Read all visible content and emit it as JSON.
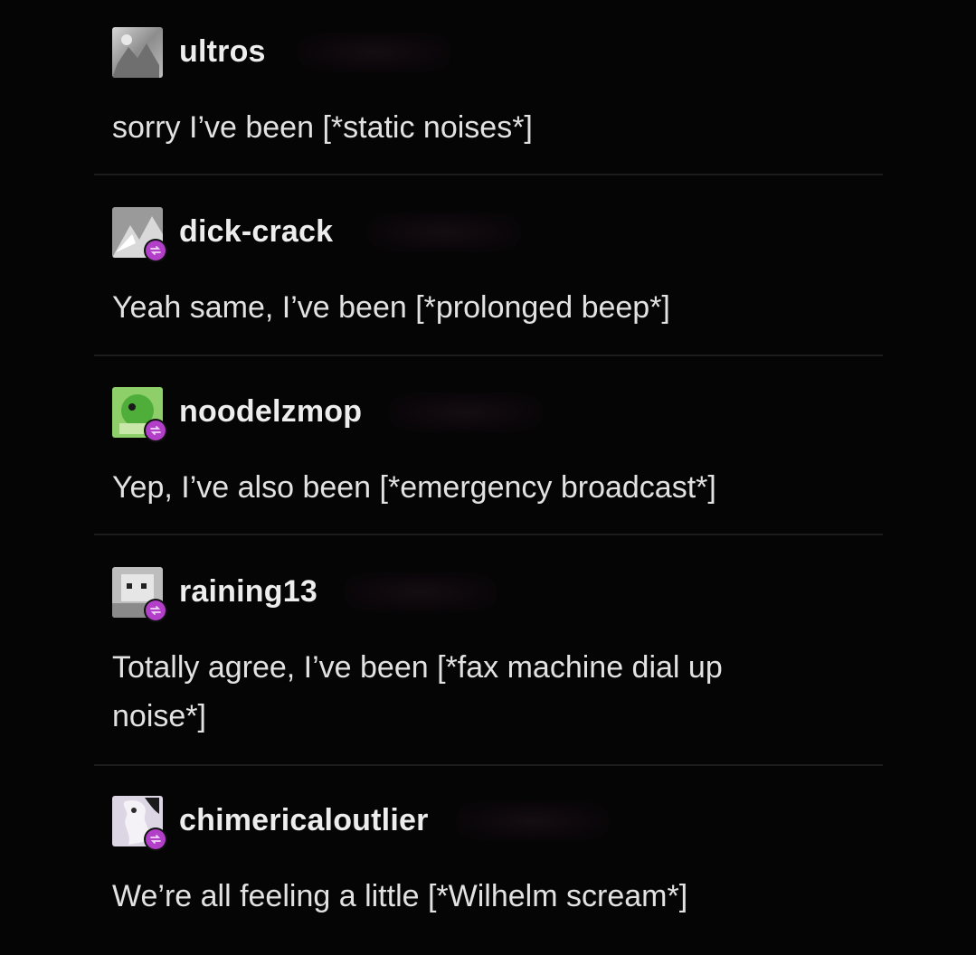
{
  "posts": [
    {
      "username": "ultros",
      "text": "sorry I’ve been [*static noises*]",
      "avatar_icon": "grey-photo-avatar-icon",
      "reblog_badge": false
    },
    {
      "username": "dick-crack",
      "text": "Yeah same, I’ve been [*prolonged beep*]",
      "avatar_icon": "grey-arrow-avatar-icon",
      "reblog_badge": true
    },
    {
      "username": "noodelzmop",
      "text": "Yep, I’ve also been [*emergency broadcast*]",
      "avatar_icon": "green-face-avatar-icon",
      "reblog_badge": true
    },
    {
      "username": "raining13",
      "text": "Totally agree, I’ve been [*fax machine dial up noise*]",
      "avatar_icon": "pixel-face-avatar-icon",
      "reblog_badge": true
    },
    {
      "username": "chimericaloutlier",
      "text": "We’re all feeling a little [*Wilhelm scream*]",
      "avatar_icon": "sketch-figure-avatar-icon",
      "reblog_badge": true
    }
  ],
  "colors": {
    "background": "#050505",
    "text": "#e2e2e2",
    "reblog_badge": "#b23fc8",
    "divider": "#1c1c1c"
  }
}
